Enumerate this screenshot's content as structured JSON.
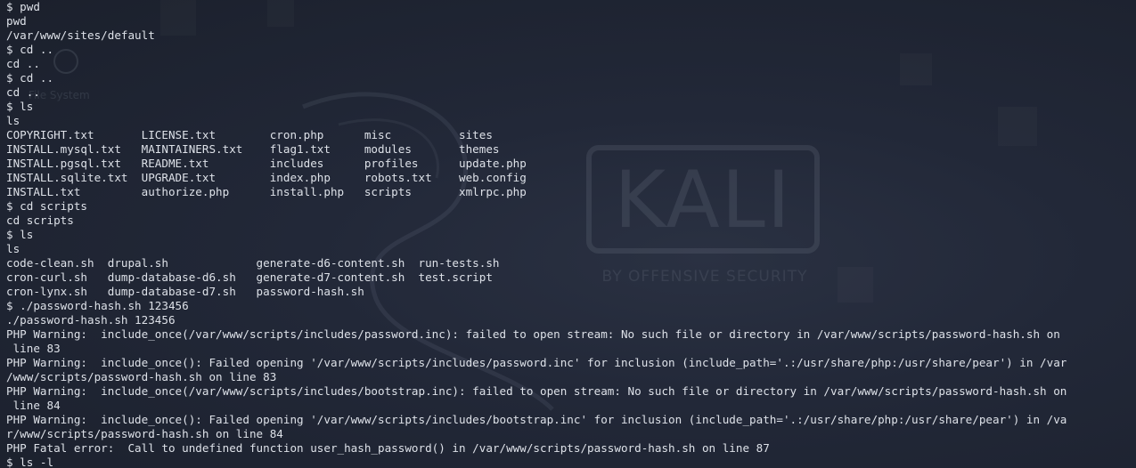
{
  "terminal": {
    "lines": [
      "$ pwd",
      "pwd",
      "/var/www/sites/default",
      "$ cd ..",
      "cd ..",
      "$ cd ..",
      "cd ..",
      "$ ls",
      "ls",
      "COPYRIGHT.txt       LICENSE.txt        cron.php      misc          sites",
      "INSTALL.mysql.txt   MAINTAINERS.txt    flag1.txt     modules       themes",
      "INSTALL.pgsql.txt   README.txt         includes      profiles      update.php",
      "INSTALL.sqlite.txt  UPGRADE.txt        index.php     robots.txt    web.config",
      "INSTALL.txt         authorize.php      install.php   scripts       xmlrpc.php",
      "$ cd scripts",
      "cd scripts",
      "$ ls",
      "ls",
      "code-clean.sh  drupal.sh             generate-d6-content.sh  run-tests.sh",
      "cron-curl.sh   dump-database-d6.sh   generate-d7-content.sh  test.script",
      "cron-lynx.sh   dump-database-d7.sh   password-hash.sh",
      "$ ./password-hash.sh 123456",
      "./password-hash.sh 123456",
      "PHP Warning:  include_once(/var/www/scripts/includes/password.inc): failed to open stream: No such file or directory in /var/www/scripts/password-hash.sh on",
      " line 83",
      "PHP Warning:  include_once(): Failed opening '/var/www/scripts/includes/password.inc' for inclusion (include_path='.:/usr/share/php:/usr/share/pear') in /var",
      "/www/scripts/password-hash.sh on line 83",
      "PHP Warning:  include_once(/var/www/scripts/includes/bootstrap.inc): failed to open stream: No such file or directory in /var/www/scripts/password-hash.sh on",
      " line 84",
      "PHP Warning:  include_once(): Failed opening '/var/www/scripts/includes/bootstrap.inc' for inclusion (include_path='.:/usr/share/php:/usr/share/pear') in /va",
      "r/www/scripts/password-hash.sh on line 84",
      "PHP Fatal error:  Call to undefined function user_hash_password() in /var/www/scripts/password-hash.sh on line 87",
      "$ ls -l"
    ]
  },
  "wallpaper": {
    "logo_text": "KALI",
    "tagline": "BY OFFENSIVE SECURITY",
    "desktop_icon_label": "File System",
    "accent": "#1d2230"
  }
}
